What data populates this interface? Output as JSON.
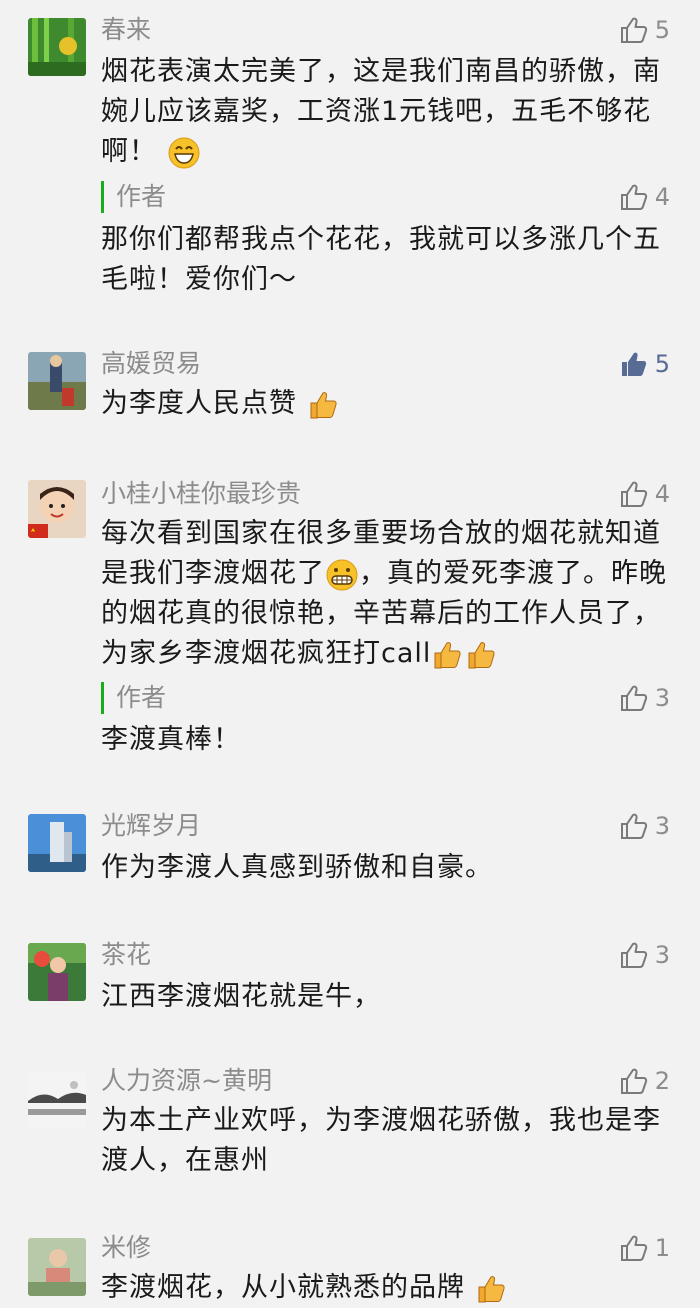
{
  "comments": [
    {
      "name": "春来",
      "likes": "5",
      "liked": false,
      "text": "烟花表演太完美了，这是我们南昌的骄傲，南婉儿应该嘉奖，工资涨1元钱吧，五毛不够花啊！",
      "reply": {
        "author": "作者",
        "likes": "4",
        "text": "那你们都帮我点个花花，我就可以多涨几个五毛啦！爱你们～"
      }
    },
    {
      "name": "高媛贸易",
      "likes": "5",
      "liked": true,
      "text": "为李度人民点赞"
    },
    {
      "name": "小桂小桂你最珍贵",
      "likes": "4",
      "liked": false,
      "text_a": "每次看到国家在很多重要场合放的烟花就知道是我们李渡烟花了",
      "text_b": "，真的爱死李渡了。昨晚的烟花真的很惊艳，辛苦幕后的工作人员了，为家乡李渡烟花疯狂打call",
      "reply": {
        "author": "作者",
        "likes": "3",
        "text": "李渡真棒！"
      }
    },
    {
      "name": "光辉岁月",
      "likes": "3",
      "liked": false,
      "text": "作为李渡人真感到骄傲和自豪。"
    },
    {
      "name": "茶花",
      "likes": "3",
      "liked": false,
      "text": "江西李渡烟花就是牛，"
    },
    {
      "name": "人力资源~黄明",
      "likes": "2",
      "liked": false,
      "text": "为本土产业欢呼，为李渡烟花骄傲，我也是李渡人，在惠州"
    },
    {
      "name": "米修",
      "likes": "1",
      "liked": false,
      "text": "李渡烟花，从小就熟悉的品牌"
    }
  ],
  "colors": {
    "background": "#f2f2f2",
    "name": "#8c8c8c",
    "author_bar": "#1aad19",
    "liked_icon": "#576b95"
  }
}
